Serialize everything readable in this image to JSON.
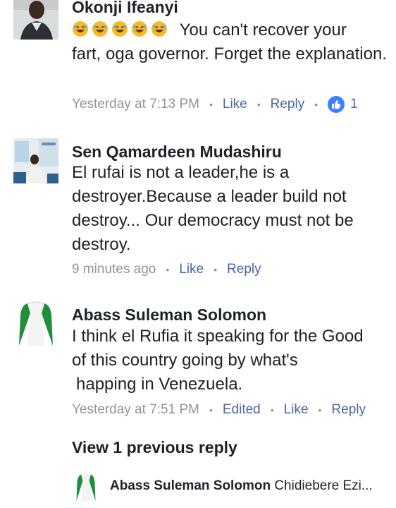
{
  "comments": [
    {
      "author": "Okonji Ifeanyi",
      "emoji": [
        "laughing-emoji",
        "laughing-emoji",
        "laughing-emoji",
        "laughing-emoji",
        "laughing-emoji"
      ],
      "text_line1": "You can't recover your",
      "text_rest": "fart, oga governor. Forget the explanation.",
      "time": "Yesterday at 7:13 PM",
      "like_label": "Like",
      "reply_label": "Reply",
      "like_count": "1"
    },
    {
      "author": "Sen Qamardeen Mudashiru",
      "text": "El rufai is not a leader,he is a destroyer.Because a leader build not destroy... Our democracy must not be destroy.",
      "time": "9 minutes ago",
      "like_label": "Like",
      "reply_label": "Reply"
    },
    {
      "author": "Abass Suleman Solomon",
      "text_line1": "I think el Rufia it speaking for the Good",
      "text_line2": "of this country going by what's",
      "text_line3": "happing in Venezuela.",
      "time": "Yesterday at 7:51 PM",
      "edited_label": "Edited",
      "like_label": "Like",
      "reply_label": "Reply"
    }
  ],
  "view_previous": "View 1 previous reply",
  "reply_preview": {
    "author": "Abass Suleman Solomon",
    "snippet": "Chidiebere Ezi..."
  },
  "colors": {
    "link": "#4b67a1",
    "meta": "#90949c",
    "like_badge": "#4080ff",
    "flag_green": "#1f8f3a"
  }
}
